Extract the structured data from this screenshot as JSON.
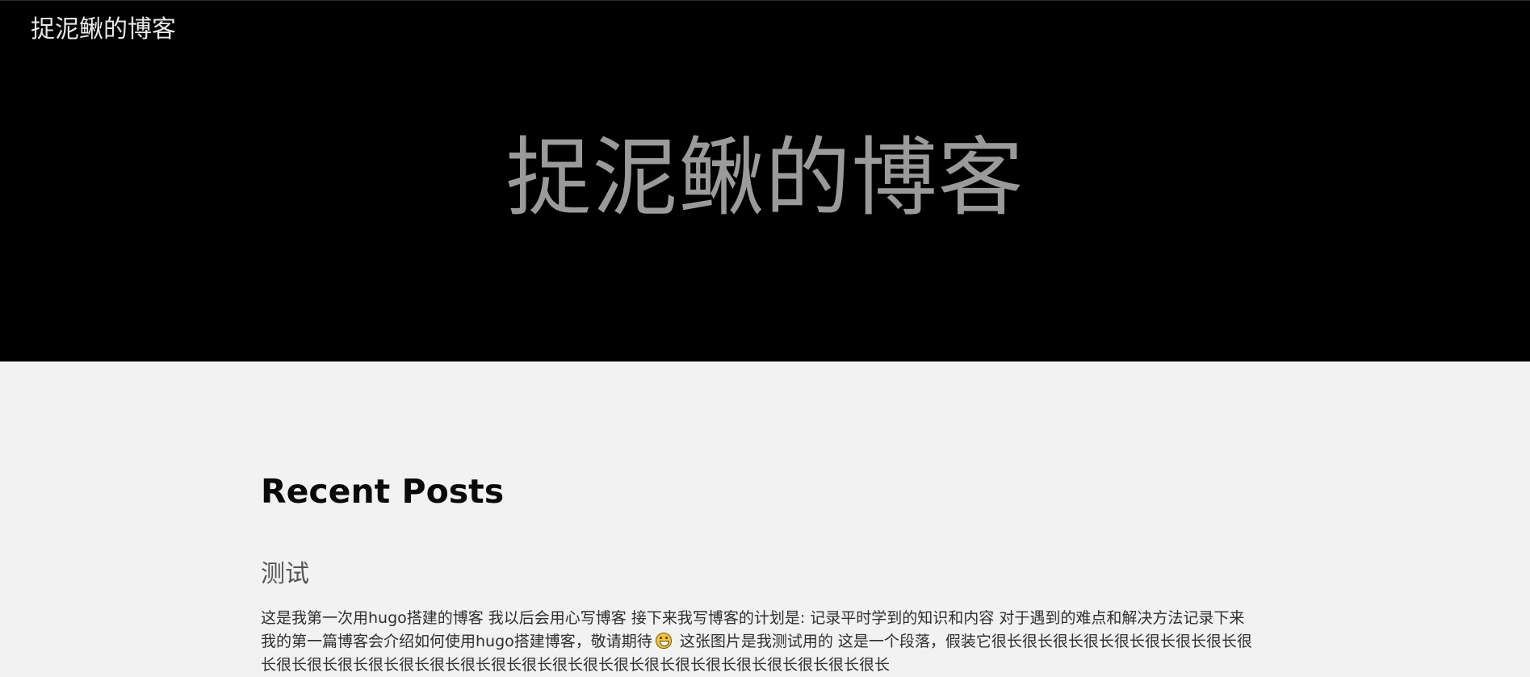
{
  "header": {
    "brand": "捉泥鳅的博客",
    "hero_title": "捉泥鳅的博客"
  },
  "main": {
    "section_heading": "Recent Posts",
    "posts": [
      {
        "title": "测试",
        "summary_before_emoji": "这是我第一次用hugo搭建的博客 我以后会用心写博客 接下来我写博客的计划是: 记录平时学到的知识和内容 对于遇到的难点和解决方法记录下来 我的第一篇博客会介绍如何使用hugo搭建博客，敬请期待",
        "emoji": "grinning-face-emoji",
        "summary_after_emoji": " 这张图片是我测试用的 这是一个段落，假装它很长很长很长很长很长很长很长很长很长很长很长很长很长很长很长很长很长很长很长很长很长很长很长很长很长很长很长很长很长"
      }
    ]
  },
  "colors": {
    "hero_background": "#000000",
    "page_background": "#f2f2f2",
    "hero_title": "#9a9a9a",
    "brand": "#e8e8e8"
  }
}
